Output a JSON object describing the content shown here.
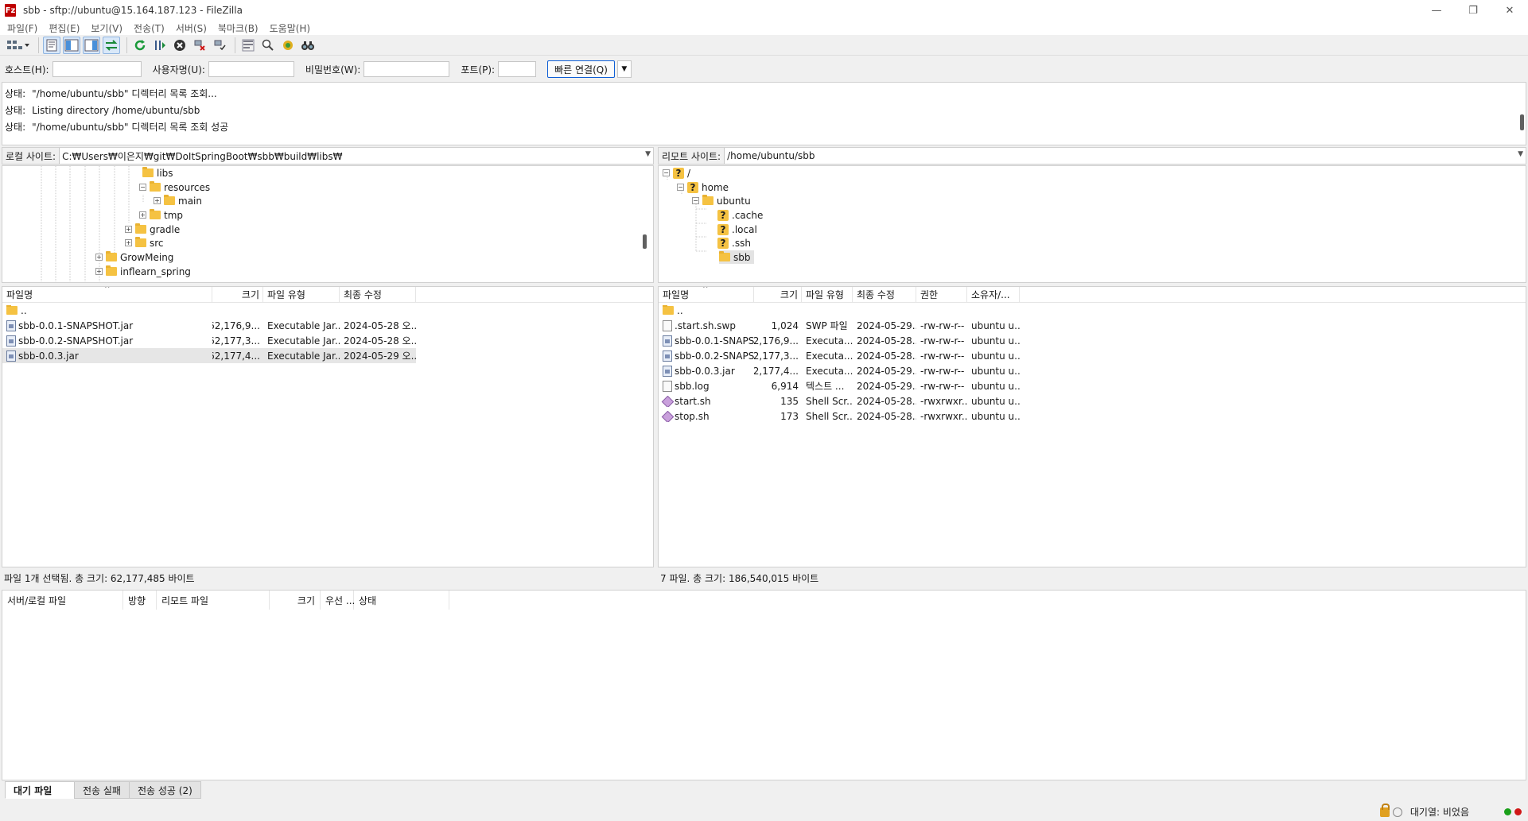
{
  "window": {
    "title": "sbb - sftp://ubuntu@15.164.187.123 - FileZilla",
    "app_icon_glyph": "Fz",
    "minimize": "—",
    "maximize": "❐",
    "close": "✕"
  },
  "menu": [
    "파일(F)",
    "편집(E)",
    "보기(V)",
    "전송(T)",
    "서버(S)",
    "북마크(B)",
    "도움말(H)"
  ],
  "toolbar": {
    "icons": [
      "site-manager-icon",
      "toggle-message-log-icon",
      "toggle-local-tree-icon",
      "toggle-remote-tree-icon",
      "toggle-queue-icon",
      "refresh-icon",
      "process-queue-icon",
      "cancel-icon",
      "disconnect-icon",
      "reconnect-icon",
      "directory-filter-icon",
      "compare-icon",
      "sync-browsing-icon",
      "search-icon"
    ]
  },
  "quickconnect": {
    "host_label": "호스트(H):",
    "host_value": "",
    "user_label": "사용자명(U):",
    "user_value": "",
    "password_label": "비밀번호(W):",
    "password_value": "",
    "port_label": "포트(P):",
    "port_value": "",
    "connect_button": "빠른 연결(Q)",
    "dropdown_glyph": "▼"
  },
  "log": [
    {
      "label": "상태:",
      "text": "\"/home/ubuntu/sbb\" 디렉터리 목록 조회..."
    },
    {
      "label": "상태:",
      "text": "Listing directory /home/ubuntu/sbb"
    },
    {
      "label": "상태:",
      "text": "\"/home/ubuntu/sbb\" 디렉터리 목록 조회 성공"
    }
  ],
  "local": {
    "site_label": "로컬 사이트:",
    "path": "C:₩Users₩이은지₩git₩DoItSpringBoot₩sbb₩build₩libs₩",
    "tree": [
      "libs",
      "resources",
      "main",
      "tmp",
      "gradle",
      "src",
      "GrowMeing",
      "inflearn_spring"
    ],
    "columns": [
      "파일명",
      "크기",
      "파일 유형",
      "최종 수정"
    ],
    "files": [
      {
        "name": "..",
        "size": "",
        "type": "",
        "modified": "",
        "icon": "folder"
      },
      {
        "name": "sbb-0.0.1-SNAPSHOT.jar",
        "size": "62,176,9...",
        "type": "Executable Jar...",
        "modified": "2024-05-28 오...",
        "icon": "jar"
      },
      {
        "name": "sbb-0.0.2-SNAPSHOT.jar",
        "size": "62,177,3...",
        "type": "Executable Jar...",
        "modified": "2024-05-28 오...",
        "icon": "jar"
      },
      {
        "name": "sbb-0.0.3.jar",
        "size": "62,177,4...",
        "type": "Executable Jar...",
        "modified": "2024-05-29 오...",
        "icon": "jar"
      }
    ],
    "selected_index": 3,
    "status": "파일 1개 선택됨. 총 크기: 62,177,485 바이트"
  },
  "remote": {
    "site_label": "리모트 사이트:",
    "path": "/home/ubuntu/sbb",
    "tree": [
      "/",
      "home",
      "ubuntu",
      ".cache",
      ".local",
      ".ssh",
      "sbb"
    ],
    "columns": [
      "파일명",
      "크기",
      "파일 유형",
      "최종 수정",
      "권한",
      "소유자/..."
    ],
    "files": [
      {
        "name": "..",
        "size": "",
        "type": "",
        "modified": "",
        "perm": "",
        "owner": "",
        "icon": "folder"
      },
      {
        "name": ".start.sh.swp",
        "size": "1,024",
        "type": "SWP 파일",
        "modified": "2024-05-29...",
        "perm": "-rw-rw-r--",
        "owner": "ubuntu u...",
        "icon": "file"
      },
      {
        "name": "sbb-0.0.1-SNAPS...",
        "size": "62,176,9...",
        "type": "Executa...",
        "modified": "2024-05-28...",
        "perm": "-rw-rw-r--",
        "owner": "ubuntu u...",
        "icon": "jar"
      },
      {
        "name": "sbb-0.0.2-SNAPS...",
        "size": "62,177,3...",
        "type": "Executa...",
        "modified": "2024-05-28...",
        "perm": "-rw-rw-r--",
        "owner": "ubuntu u...",
        "icon": "jar"
      },
      {
        "name": "sbb-0.0.3.jar",
        "size": "62,177,4...",
        "type": "Executa...",
        "modified": "2024-05-29...",
        "perm": "-rw-rw-r--",
        "owner": "ubuntu u...",
        "icon": "jar"
      },
      {
        "name": "sbb.log",
        "size": "6,914",
        "type": "텍스트 ...",
        "modified": "2024-05-29...",
        "perm": "-rw-rw-r--",
        "owner": "ubuntu u...",
        "icon": "file"
      },
      {
        "name": "start.sh",
        "size": "135",
        "type": "Shell Scr...",
        "modified": "2024-05-28...",
        "perm": "-rwxrwxr...",
        "owner": "ubuntu u...",
        "icon": "sh"
      },
      {
        "name": "stop.sh",
        "size": "173",
        "type": "Shell Scr...",
        "modified": "2024-05-28...",
        "perm": "-rwxrwxr...",
        "owner": "ubuntu u...",
        "icon": "sh"
      }
    ],
    "status": "7 파일. 총 크기: 186,540,015 바이트"
  },
  "queue": {
    "columns": [
      "서버/로컬 파일",
      "방향",
      "리모트 파일",
      "크기",
      "우선 ...",
      "상태"
    ],
    "tabs": [
      "대기 파일",
      "전송 실패",
      "전송 성공 (2)"
    ],
    "active_tab": 0
  },
  "statusbar": {
    "queue_text": "대기열: 비었음",
    "led_colors": [
      "#1aa01a",
      "#d01818"
    ]
  }
}
